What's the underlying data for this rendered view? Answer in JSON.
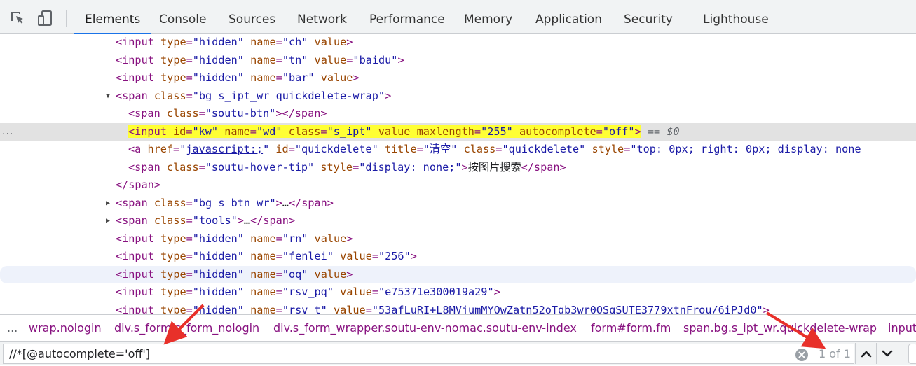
{
  "toolbar": {
    "inspect_icon": "element-picker-icon",
    "device_icon": "device-toggle-icon"
  },
  "tabs": [
    "Elements",
    "Console",
    "Sources",
    "Network",
    "Performance",
    "Memory",
    "Application",
    "Security",
    "Lighthouse"
  ],
  "active_tab": "Elements",
  "tree": {
    "row0": {
      "open": "<input",
      "a1": "type",
      "v1": "\"hidden\"",
      "a2": "name",
      "v2": "\"ch\"",
      "a3": "value",
      "close": ">"
    },
    "row1": {
      "open": "<input",
      "a1": "type",
      "v1": "\"hidden\"",
      "a2": "name",
      "v2": "\"tn\"",
      "a3": "value",
      "eq3": "=",
      "v3": "\"baidu\"",
      "close": ">"
    },
    "row2": {
      "open": "<input",
      "a1": "type",
      "v1": "\"hidden\"",
      "a2": "name",
      "v2": "\"bar\"",
      "a3": "value",
      "close": ">"
    },
    "row3": {
      "triangle": "▼",
      "open": "<span",
      "a1": "class",
      "v1": "\"bg s_ipt_wr quickdelete-wrap\"",
      "close": ">"
    },
    "row4": {
      "open": "<span",
      "a1": "class",
      "v1": "\"soutu-btn\"",
      "mid": "></",
      "tagname": "span",
      "close": ">"
    },
    "row5": {
      "dots": "...",
      "open": "<input",
      "a1": "id",
      "v1": "\"kw\"",
      "a2": "name",
      "v2": "\"wd\"",
      "a3": "class",
      "v3": "\"s_ipt\"",
      "a4": "value",
      "a5": "maxlength",
      "v5": "\"255\"",
      "a6": "autocomplete",
      "v6": "\"off\"",
      "close": ">",
      "eq": "==",
      "dollar": "$0"
    },
    "row6": {
      "open": "<a",
      "a1": "href",
      "q1": "\"",
      "link": "javascript:;",
      "q2": "\"",
      "a2": "id",
      "v2": "\"quickdelete\"",
      "a3": "title",
      "v3": "\"清空\"",
      "a4": "class",
      "v4": "\"quickdelete\"",
      "a5": "style",
      "v5": "\"top: 0px; right: 0px; display: none"
    },
    "row7": {
      "open": "<span",
      "a1": "class",
      "v1": "\"soutu-hover-tip\"",
      "a2": "style",
      "v2": "\"display: none;\"",
      "gt": ">",
      "text": "按图片搜索",
      "end": "</span>"
    },
    "row8": {
      "text": "</span>"
    },
    "row9": {
      "triangle": "▶",
      "open": "<span",
      "a1": "class",
      "v1": "\"bg s_btn_wr\"",
      "gt": ">",
      "ellipsis": "…",
      "end": "</span>"
    },
    "row10": {
      "triangle": "▶",
      "open": "<span",
      "a1": "class",
      "v1": "\"tools\"",
      "gt": ">",
      "ellipsis": "…",
      "end": "</span>"
    },
    "row11": {
      "open": "<input",
      "a1": "type",
      "v1": "\"hidden\"",
      "a2": "name",
      "v2": "\"rn\"",
      "a3": "value",
      "close": ">"
    },
    "row12": {
      "open": "<input",
      "a1": "type",
      "v1": "\"hidden\"",
      "a2": "name",
      "v2": "\"fenlei\"",
      "a3": "value",
      "eq3": "=",
      "v3": "\"256\"",
      "close": ">"
    },
    "row13": {
      "open": "<input",
      "a1": "type",
      "v1": "\"hidden\"",
      "a2": "name",
      "v2": "\"oq\"",
      "a3": "value",
      "close": ">"
    },
    "row14": {
      "open": "<input",
      "a1": "type",
      "v1": "\"hidden\"",
      "a2": "name",
      "v2": "\"rsv_pq\"",
      "a3": "value",
      "eq3": "=",
      "v3": "\"e75371e300019a29\"",
      "close": ">"
    },
    "row15": {
      "open": "<input",
      "a1": "type",
      "v1": "\"hidden\"",
      "a2": "name",
      "v2": "\"rsv_t\"",
      "a3": "value",
      "eq3": "=",
      "v3": "\"53afLuRI+L8MVjumMYQwZatn52oTqb3wr0OSqSUTE3779xtnFrou/6iPJd0\"",
      "close": ">"
    }
  },
  "breadcrumbs": {
    "dots": "...",
    "items": [
      "wrap.nologin",
      "div.s_form.s_form_nologin",
      "div.s_form_wrapper.soutu-env-nomac.soutu-env-index",
      "form#form.fm",
      "span.bg.s_ipt_wr.quickdelete-wrap",
      "input"
    ]
  },
  "search": {
    "value": "//*[@autocomplete='off']",
    "match_count": "1 of 1",
    "clear_icon": "clear-circle-icon",
    "prev_icon": "chevron-up-icon",
    "next_icon": "chevron-down-icon"
  },
  "colors": {
    "accent": "#1a73e8",
    "tag": "#881280",
    "attribute": "#994500",
    "attribute_value": "#1a1aa6",
    "highlight": "#ffff34",
    "annotation_arrow": "#e8302a"
  }
}
